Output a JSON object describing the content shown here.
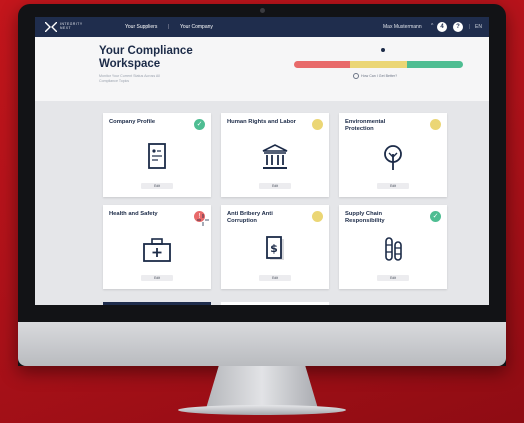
{
  "nav": {
    "logo_line1": "INTEGRITY",
    "logo_line2": "NEXT",
    "link_suppliers": "Your Suppliers",
    "separator": "|",
    "link_company": "Your Company",
    "user_name": "Max Mustermann",
    "badge_alerts": "4",
    "badge_help": "?",
    "lang_separator": "|",
    "language": "EN"
  },
  "header": {
    "title": "Your Compliance Workspace",
    "subtitle": "Monitor Your Current Status Across All Compliance Topics",
    "help_link": "How Can I Get Better?"
  },
  "colors": {
    "navy": "#1f2d4d",
    "red": "#e86a6a",
    "yellow": "#ebd675",
    "green": "#4ebd92"
  },
  "cards": [
    {
      "title": "Company Profile",
      "status": "green",
      "status_symbol": "✓",
      "icon": "document-icon",
      "edit": "Edit"
    },
    {
      "title": "Human Rights and Labor",
      "status": "yellow",
      "status_symbol": "",
      "icon": "institution-icon",
      "edit": "Edit"
    },
    {
      "title": "Environmental Protection",
      "status": "yellow",
      "status_symbol": "",
      "icon": "tree-icon",
      "edit": "Edit"
    },
    {
      "title": "Health and Safety",
      "status": "red",
      "status_symbol": "!",
      "icon": "first-aid-kit-icon",
      "edit": "Edit"
    },
    {
      "title": "Anti Bribery Anti Corruption",
      "status": "yellow",
      "status_symbol": "",
      "icon": "money-document-icon",
      "edit": "Edit"
    },
    {
      "title": "Supply Chain Responsibility",
      "status": "green",
      "status_symbol": "✓",
      "icon": "chain-icon",
      "edit": "Edit"
    }
  ]
}
